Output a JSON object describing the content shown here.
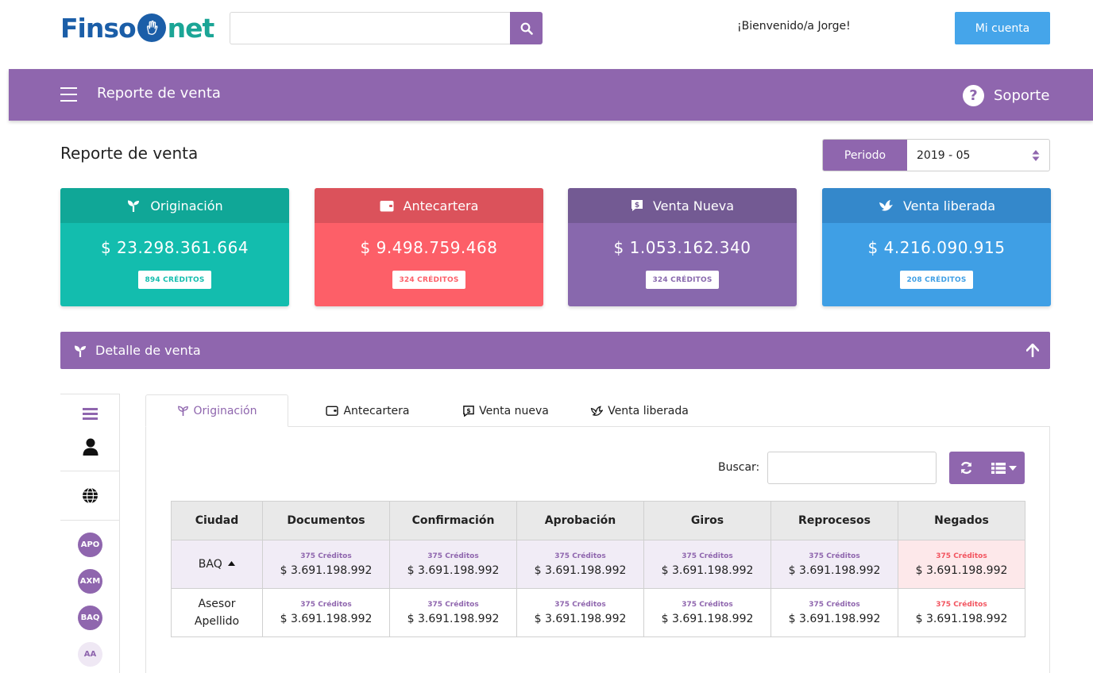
{
  "header": {
    "logo_part1": "Finso",
    "logo_part2": "net",
    "search_placeholder": "",
    "welcome": "¡Bienvenido/a Jorge!",
    "account_button": "Mi cuenta"
  },
  "navbar": {
    "title": "Reporte de venta",
    "support": "Soporte"
  },
  "page": {
    "title": "Reporte de venta",
    "period_label": "Periodo",
    "period_value": "2019 - 05"
  },
  "cards": [
    {
      "title": "Originación",
      "amount": "$ 23.298.361.664",
      "badge": "894 CRÉDITOS",
      "icon": "sprout-icon"
    },
    {
      "title": "Antecartera",
      "amount": "$ 9.498.759.468",
      "badge": "324 CRÉDITOS",
      "icon": "wallet-icon"
    },
    {
      "title": "Venta Nueva",
      "amount": "$ 1.053.162.340",
      "badge": "324 CRÉDITOS",
      "icon": "money-chat-icon"
    },
    {
      "title": "Venta liberada",
      "amount": "$ 4.216.090.915",
      "badge": "208 CRÉDITOS",
      "icon": "dove-icon"
    }
  ],
  "detail": {
    "title": "Detalle de venta"
  },
  "sidebar": {
    "items": [
      "APO",
      "AXM",
      "BAQ",
      "AA"
    ]
  },
  "tabs": [
    {
      "label": "Originación",
      "active": true
    },
    {
      "label": "Antecartera",
      "active": false
    },
    {
      "label": "Venta nueva",
      "active": false
    },
    {
      "label": "Venta liberada",
      "active": false
    }
  ],
  "table": {
    "search_label": "Buscar:",
    "columns": [
      "Ciudad",
      "Documentos",
      "Confirmación",
      "Aprobación",
      "Giros",
      "Reprocesos",
      "Negados"
    ],
    "rows": [
      {
        "city": "BAQ",
        "city_line2": "",
        "cells": [
          {
            "credits": "375 Créditos",
            "amount": "$ 3.691.198.992"
          },
          {
            "credits": "375 Créditos",
            "amount": "$ 3.691.198.992"
          },
          {
            "credits": "375 Créditos",
            "amount": "$ 3.691.198.992"
          },
          {
            "credits": "375 Créditos",
            "amount": "$ 3.691.198.992"
          },
          {
            "credits": "375 Créditos",
            "amount": "$ 3.691.198.992"
          },
          {
            "credits": "375 Créditos",
            "amount": "$ 3.691.198.992"
          }
        ]
      },
      {
        "city": "Asesor",
        "city_line2": "Apellido",
        "cells": [
          {
            "credits": "375 Créditos",
            "amount": "$ 3.691.198.992"
          },
          {
            "credits": "375 Créditos",
            "amount": "$ 3.691.198.992"
          },
          {
            "credits": "375 Créditos",
            "amount": "$ 3.691.198.992"
          },
          {
            "credits": "375 Créditos",
            "amount": "$ 3.691.198.992"
          },
          {
            "credits": "375 Créditos",
            "amount": "$ 3.691.198.992"
          },
          {
            "credits": "375 Créditos",
            "amount": "$ 3.691.198.992"
          }
        ]
      }
    ]
  },
  "colors": {
    "brand_purple": "#8f66ae",
    "teal": "#13bdae",
    "red": "#fd5f68",
    "violet": "#8868ad",
    "blue": "#3f9fe5"
  }
}
